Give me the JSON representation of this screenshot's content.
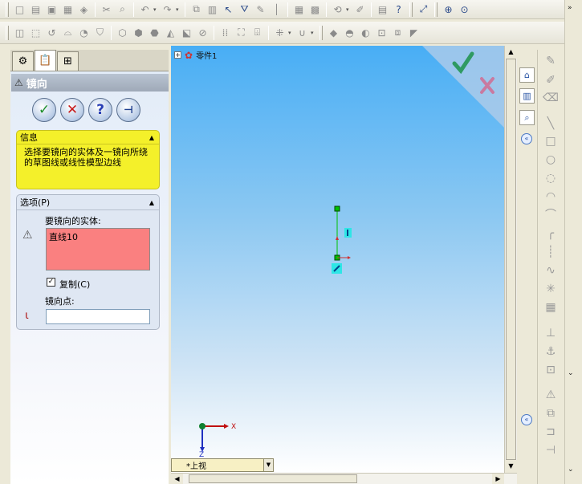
{
  "toolbar_row1": [
    "new-icon",
    "open-icon",
    "save-icon",
    "print-icon",
    "undo-icon",
    "redo-icon",
    "select-icon",
    "rebuild-icon",
    "options-icon",
    "help-icon",
    "zoom-fit-icon",
    "zoom-area-icon"
  ],
  "toolbar_row2": [
    "sketch-icon",
    "smart-dimension-icon",
    "line-icon",
    "rectangle-icon",
    "circle-icon",
    "arc-icon",
    "polygon-icon",
    "spline-icon",
    "point-icon",
    "centerline-icon",
    "text-icon",
    "trim-icon",
    "offset-icon",
    "mirror-icon"
  ],
  "property_manager": {
    "title": "镜向",
    "info": {
      "header": "信息",
      "text": "选择要镜向的实体及一镜向所绕的草图线或线性模型边线"
    },
    "options": {
      "header": "选项(P)",
      "entities_label": "要镜向的实体:",
      "entities_value": "直线10",
      "copy_label": "复制(C)",
      "copy_checked": true,
      "copy_mark": "✓",
      "mirror_point_label": "镜向点:",
      "mirror_point_value": ""
    }
  },
  "graphics": {
    "tree_item": "零件1",
    "tree_expand": "+",
    "view_label": "*上视",
    "axis_x": "X",
    "axis_z": "Z"
  },
  "colors": {
    "info_bg": "#f4f02a",
    "selection_bg": "#fa8080",
    "sketch_line": "#00c000",
    "accept": "#2f9a62",
    "reject": "#c97aa0"
  },
  "task_pane": [
    "home-icon",
    "design-library-icon",
    "file-explorer-icon"
  ],
  "sketch_toolbar": [
    "line-tool-icon",
    "rectangle-tool-icon",
    "circle-tool-icon",
    "arc-tool-icon",
    "polygon-tool-icon",
    "spline-tool-icon",
    "point-tool-icon",
    "centerline-tool-icon",
    "ellipse-tool-icon",
    "fillet-tool-icon",
    "chamfer-tool-icon",
    "offset-tool-icon",
    "convert-entities-icon",
    "trim-tool-icon"
  ]
}
